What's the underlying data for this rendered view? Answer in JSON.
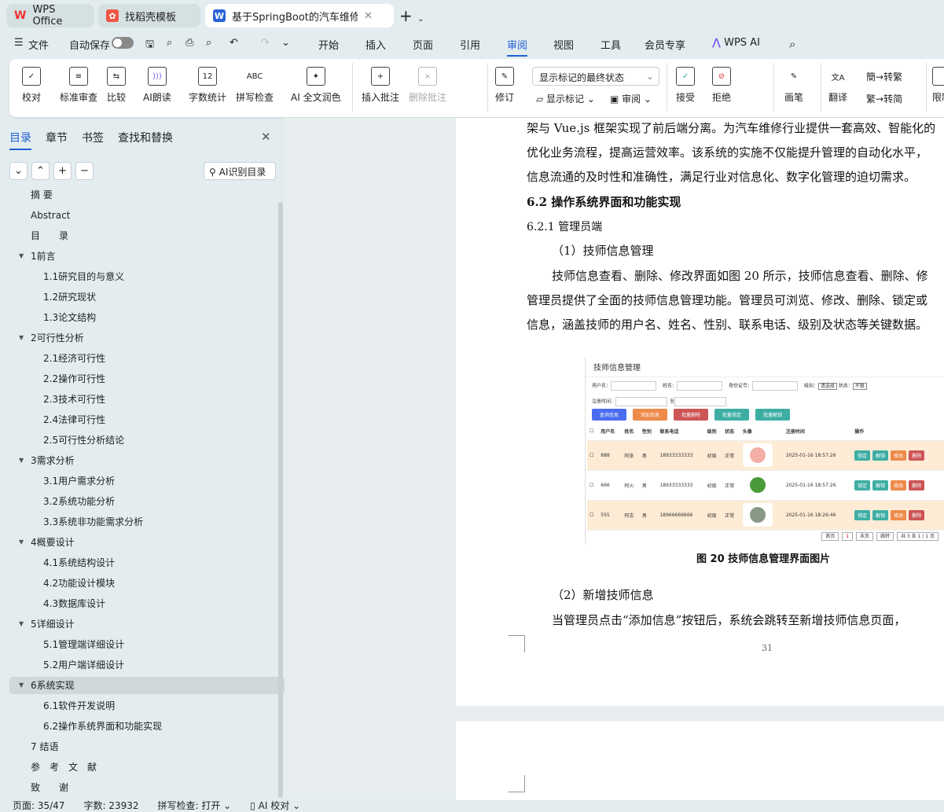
{
  "tabs": [
    {
      "label": "WPS Office"
    },
    {
      "label": "找稻壳模板"
    },
    {
      "label": "基于SpringBoot的汽车维修管"
    }
  ],
  "menu": {
    "file": "文件",
    "autosave": "自动保存",
    "items": [
      "开始",
      "插入",
      "页面",
      "引用",
      "审阅",
      "视图",
      "工具",
      "会员专享"
    ],
    "active": "审阅",
    "wps_ai": "WPS AI"
  },
  "ribbon": {
    "proof": "校对",
    "std_review": "标准审查",
    "compare": "比较",
    "ai_read": "AI朗读",
    "word_count": "字数统计",
    "spell": "拼写检查",
    "ai_polish": "AI 全文润色",
    "insert_comment": "插入批注",
    "delete_comment": "删除批注",
    "track": "修订",
    "display_select": "显示标记的最终状态",
    "show_marks": "显示标记",
    "review": "审阅",
    "accept": "接受",
    "reject": "拒绝",
    "pen": "画笔",
    "translate": "翻译",
    "to_trad": "转繁",
    "to_simp": "转简",
    "restrict": "限制"
  },
  "panel": {
    "tabs": [
      "目录",
      "章节",
      "书签",
      "查找和替换"
    ],
    "ai_toc": "AI识别目录",
    "toc": [
      {
        "label": "摘 要",
        "level": 0
      },
      {
        "label": "Abstract",
        "level": 0
      },
      {
        "label": "目　　录",
        "level": 0
      },
      {
        "label": "1前言",
        "level": 0,
        "expand": true
      },
      {
        "label": "1.1研究目的与意义",
        "level": 1
      },
      {
        "label": "1.2研究现状",
        "level": 1
      },
      {
        "label": "1.3论文结构",
        "level": 1
      },
      {
        "label": "2可行性分析",
        "level": 0,
        "expand": true
      },
      {
        "label": "2.1经济可行性",
        "level": 1
      },
      {
        "label": "2.2操作可行性",
        "level": 1
      },
      {
        "label": "2.3技术可行性",
        "level": 1
      },
      {
        "label": "2.4法律可行性",
        "level": 1
      },
      {
        "label": "2.5可行性分析结论",
        "level": 1
      },
      {
        "label": "3需求分析",
        "level": 0,
        "expand": true
      },
      {
        "label": "3.1用户需求分析",
        "level": 1
      },
      {
        "label": "3.2系统功能分析",
        "level": 1
      },
      {
        "label": "3.3系统非功能需求分析",
        "level": 1
      },
      {
        "label": "4概要设计",
        "level": 0,
        "expand": true
      },
      {
        "label": "4.1系统结构设计",
        "level": 1
      },
      {
        "label": "4.2功能设计模块",
        "level": 1
      },
      {
        "label": "4.3数据库设计",
        "level": 1
      },
      {
        "label": "5详细设计",
        "level": 0,
        "expand": true
      },
      {
        "label": "5.1管理端详细设计",
        "level": 1
      },
      {
        "label": "5.2用户端详细设计",
        "level": 1
      },
      {
        "label": "6系统实现",
        "level": 0,
        "expand": true,
        "selected": true
      },
      {
        "label": "6.1软件开发说明",
        "level": 1
      },
      {
        "label": "6.2操作系统界面和功能实现",
        "level": 1
      },
      {
        "label": "7 结语",
        "level": 0
      },
      {
        "label": "参　考　文　献",
        "level": 0
      },
      {
        "label": "致　　谢",
        "level": 0
      }
    ]
  },
  "doc": {
    "lines": [
      "架与 Vue.js 框架实现了前后端分离。为汽车维修行业提供一套高效、智能化的",
      "优化业务流程，提高运营效率。该系统的实施不仅能提升管理的自动化水平，",
      "信息流通的及时性和准确性，满足行业对信息化、数字化管理的迫切需求。"
    ],
    "h2": "6.2 操作系统界面和功能实现",
    "h3": "6.2.1 管理员端",
    "h4": "（1）技师信息管理",
    "p2": [
      "技师信息查看、删除、修改界面如图 20 所示，技师信息查看、删除、修",
      "管理员提供了全面的技师信息管理功能。管理员可浏览、修改、删除、锁定或",
      "信息，涵盖技师的用户名、姓名、性别、联系电话、级别及状态等关键数据。"
    ],
    "caption": "图 20 技师信息管理界面图片",
    "h4b": "（2）新增技师信息",
    "p3": "当管理员点击“添加信息”按钮后，系统会跳转至新增技师信息页面，",
    "page_no": "31"
  },
  "figure": {
    "title": "技师信息管理",
    "filters": [
      "用户名：",
      "姓名：",
      "身份证号：",
      "级别：",
      "请选择",
      "状态：",
      "不限",
      "注册时间：",
      "至"
    ],
    "buttons": [
      {
        "label": "查询信息",
        "color": "#4a6cf0"
      },
      {
        "label": "添加信息",
        "color": "#ee8a4a"
      },
      {
        "label": "批量删除",
        "color": "#cc5555"
      },
      {
        "label": "批量锁定",
        "color": "#3eaea4"
      },
      {
        "label": "批量解锁",
        "color": "#3eaea4"
      }
    ],
    "headers": [
      "用户名",
      "姓名",
      "性别",
      "联系电话",
      "级别",
      "状态",
      "头像",
      "注册时间",
      "操作"
    ],
    "rows": [
      [
        "888",
        "阿张",
        "男",
        "18933333333",
        "初级",
        "正常",
        "2025-01-16 18:57:26"
      ],
      [
        "666",
        "阿火",
        "男",
        "18933333333",
        "初级",
        "正常",
        "2025-01-16 18:57:26"
      ],
      [
        "555",
        "阿志",
        "男",
        "18966666666",
        "初级",
        "正常",
        "2025-01-16 18:26:46"
      ]
    ],
    "actions": [
      "锁定",
      "解锁",
      "修改",
      "删除"
    ],
    "pager": [
      "首页",
      "1",
      "末页",
      "跳转",
      "共 3 条  1 / 1 页"
    ]
  },
  "status": {
    "page": "页面: 35/47",
    "words": "字数: 23932",
    "spell": "拼写检查: 打开",
    "ai": "AI 校对"
  }
}
